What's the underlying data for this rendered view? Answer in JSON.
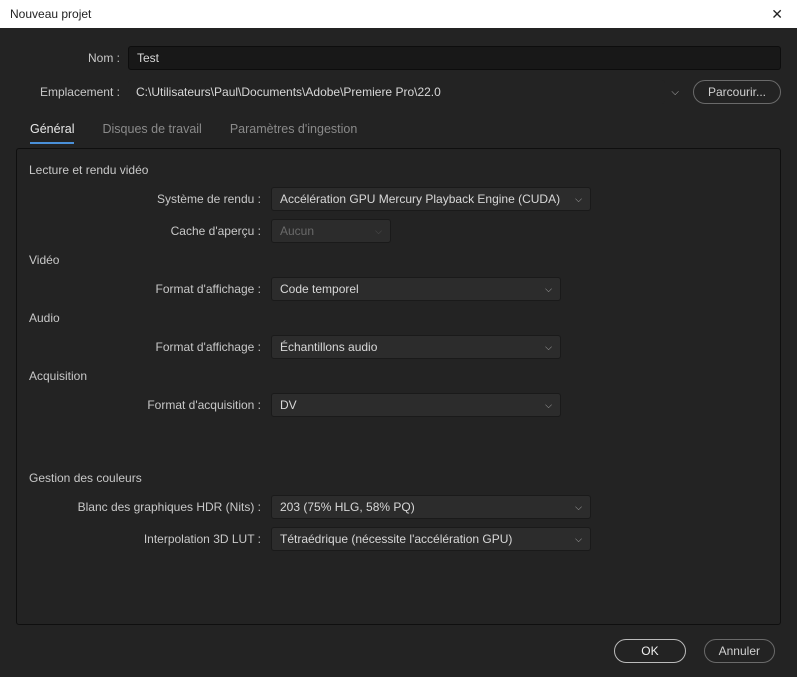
{
  "window": {
    "title": "Nouveau projet",
    "close_icon": "✕"
  },
  "top": {
    "name_label": "Nom :",
    "name_value": "Test",
    "location_label": "Emplacement :",
    "location_value": "C:\\Utilisateurs\\Paul\\Documents\\Adobe\\Premiere Pro\\22.0",
    "browse_label": "Parcourir..."
  },
  "tabs": {
    "general": "Général",
    "scratch": "Disques de travail",
    "ingest": "Paramètres d'ingestion"
  },
  "sections": {
    "playback": {
      "title": "Lecture et rendu vidéo",
      "renderer_label": "Système de rendu :",
      "renderer_value": "Accélération GPU Mercury Playback Engine (CUDA)",
      "cache_label": "Cache d'aperçu :",
      "cache_value": "Aucun"
    },
    "video": {
      "title": "Vidéo",
      "display_label": "Format d'affichage :",
      "display_value": "Code temporel"
    },
    "audio": {
      "title": "Audio",
      "display_label": "Format d'affichage :",
      "display_value": "Échantillons audio"
    },
    "capture": {
      "title": "Acquisition",
      "format_label": "Format d'acquisition :",
      "format_value": "DV"
    },
    "color": {
      "title": "Gestion des couleurs",
      "hdr_label": "Blanc des graphiques HDR (Nits) :",
      "hdr_value": "203 (75% HLG, 58% PQ)",
      "lut_label": "Interpolation 3D LUT :",
      "lut_value": "Tétraédrique (nécessite l'accélération GPU)"
    }
  },
  "footer": {
    "ok": "OK",
    "cancel": "Annuler"
  }
}
